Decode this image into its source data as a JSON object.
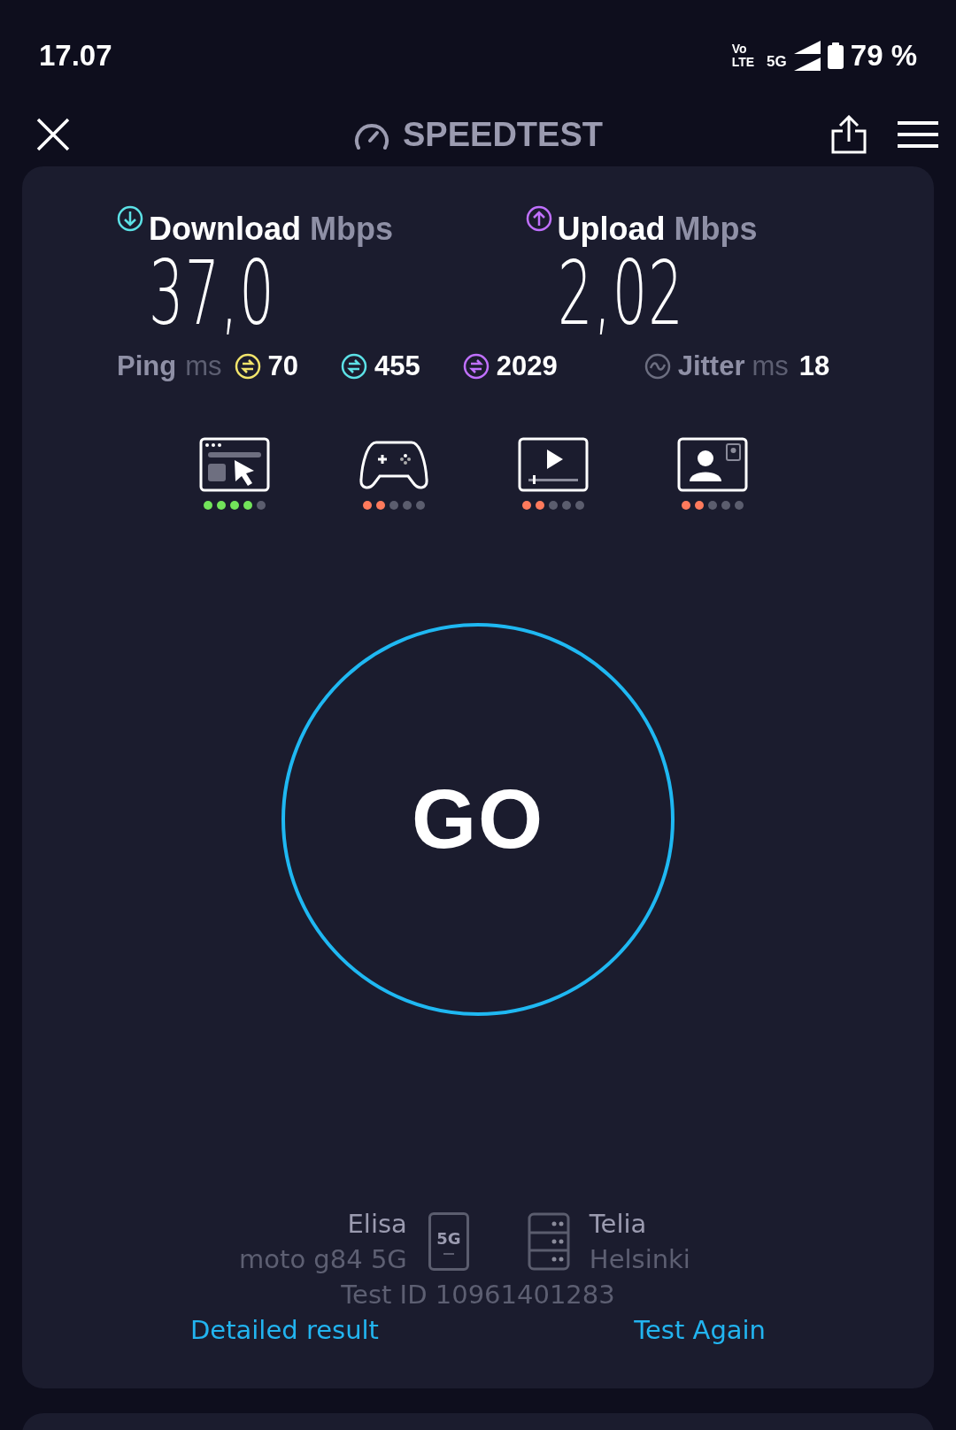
{
  "status_bar": {
    "time": "17.07",
    "volte_top": "Vo",
    "volte_bottom": "LTE",
    "network": "5G",
    "battery": "79 %"
  },
  "header": {
    "title": "SPEEDTEST"
  },
  "download": {
    "label": "Download",
    "unit": "Mbps",
    "value": "37,0"
  },
  "upload": {
    "label": "Upload",
    "unit": "Mbps",
    "value": "2,02"
  },
  "ping": {
    "label": "Ping",
    "unit": "ms",
    "readings": [
      {
        "kind": "idle",
        "value": "70"
      },
      {
        "kind": "download",
        "value": "455"
      },
      {
        "kind": "upload",
        "value": "2029"
      }
    ]
  },
  "jitter": {
    "label": "Jitter",
    "unit": "ms",
    "value": "18"
  },
  "experience": [
    {
      "kind": "browsing",
      "stars": 4
    },
    {
      "kind": "gaming",
      "stars": 2
    },
    {
      "kind": "video",
      "stars": 2
    },
    {
      "kind": "video_call",
      "stars": 2
    }
  ],
  "go_button": "GO",
  "provider": {
    "name": "Elisa",
    "device": "moto g84 5G",
    "badge": "5G"
  },
  "server": {
    "name": "Telia",
    "location": "Helsinki"
  },
  "test_id": "Test ID 10961401283",
  "links": [
    "Detailed result",
    "Test Again"
  ]
}
